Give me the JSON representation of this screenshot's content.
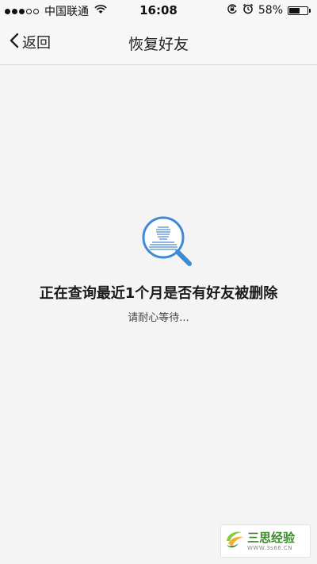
{
  "status_bar": {
    "carrier": "中国联通",
    "time": "16:08",
    "battery_percent": "58%",
    "battery_level": 0.58,
    "signal_bars_filled": 3,
    "signal_bars_total": 5
  },
  "nav": {
    "back_label": "返回",
    "title": "恢复好友"
  },
  "main": {
    "message_title": "正在查询最近1个月是否有好友被删除",
    "message_subtitle": "请耐心等待..."
  },
  "watermark": {
    "name": "三思经验",
    "url": "WWW.3s66.CN"
  },
  "colors": {
    "accent": "#3d8bd6",
    "background": "#f4f4f4",
    "watermark_green": "#3a8a2a"
  }
}
